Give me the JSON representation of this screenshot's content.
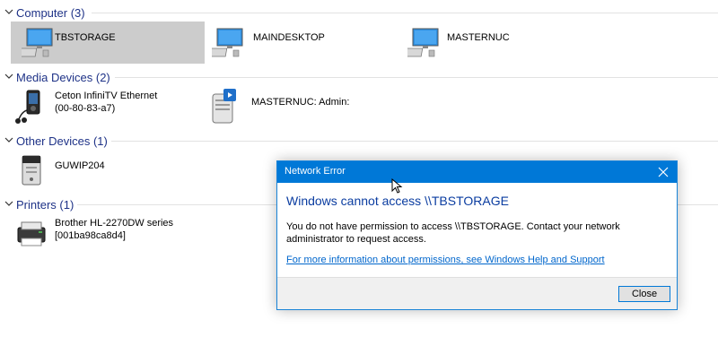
{
  "groups": [
    {
      "title": "Computer (3)",
      "items": [
        {
          "label": "TBSTORAGE",
          "icon": "computer-icon",
          "selected": true
        },
        {
          "label": "MAINDESKTOP",
          "icon": "computer-icon"
        },
        {
          "label": "MASTERNUC",
          "icon": "computer-icon"
        }
      ]
    },
    {
      "title": "Media Devices (2)",
      "items": [
        {
          "label_line1": "Ceton InfiniTV Ethernet",
          "label_line2": "(00-80-83-a7)",
          "icon": "media-player-icon"
        },
        {
          "label": "MASTERNUC: Admin:",
          "icon": "media-server-icon"
        }
      ]
    },
    {
      "title": "Other Devices (1)",
      "items": [
        {
          "label": "GUWIP204",
          "icon": "generic-device-icon"
        }
      ]
    },
    {
      "title": "Printers (1)",
      "items": [
        {
          "label_line1": "Brother HL-2270DW series",
          "label_line2": "[001ba98ca8d4]",
          "icon": "printer-icon"
        }
      ]
    }
  ],
  "dialog": {
    "title": "Network Error",
    "heading": "Windows cannot access \\\\TBSTORAGE",
    "message": "You do not have permission to access \\\\TBSTORAGE. Contact your network administrator to request access.",
    "link": "For more information about permissions, see Windows Help and Support",
    "close_label": "Close"
  },
  "colors": {
    "group_header": "#1e3287",
    "selection": "#cccccc",
    "dialog_titlebar": "#0078d7",
    "dialog_heading": "#0a3ca0",
    "link": "#0066cc"
  }
}
